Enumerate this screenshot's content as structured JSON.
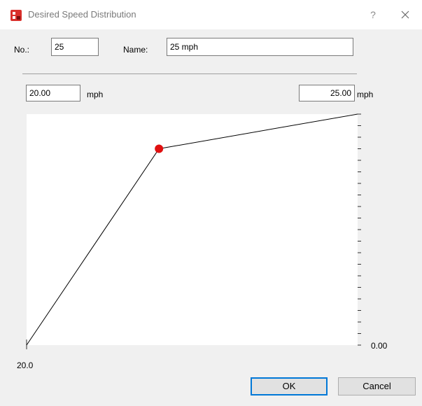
{
  "window": {
    "title": "Desired Speed Distribution",
    "help_glyph": "?",
    "icon": "app-icon"
  },
  "form": {
    "no_label": "No.:",
    "no_value": "25",
    "name_label": "Name:",
    "name_value": "25 mph"
  },
  "range": {
    "min_value": "20.00",
    "min_unit": "mph",
    "max_value": "25.00",
    "max_unit": "mph"
  },
  "chart_data": {
    "type": "line",
    "x": [
      20.0,
      22.0,
      25.0
    ],
    "y": [
      0.0,
      0.85,
      1.0
    ],
    "xlim": [
      20.0,
      25.0
    ],
    "ylim": [
      0.0,
      1.0
    ],
    "x_start_label": "20.0",
    "y_min_label": "0.00",
    "highlight_point_index": 1,
    "line_color": "#000000",
    "point_color": "#e01010",
    "grid": false
  },
  "buttons": {
    "ok_label": "OK",
    "cancel_label": "Cancel"
  },
  "colors": {
    "accent": "#0078d7",
    "icon_red": "#d9302c"
  }
}
